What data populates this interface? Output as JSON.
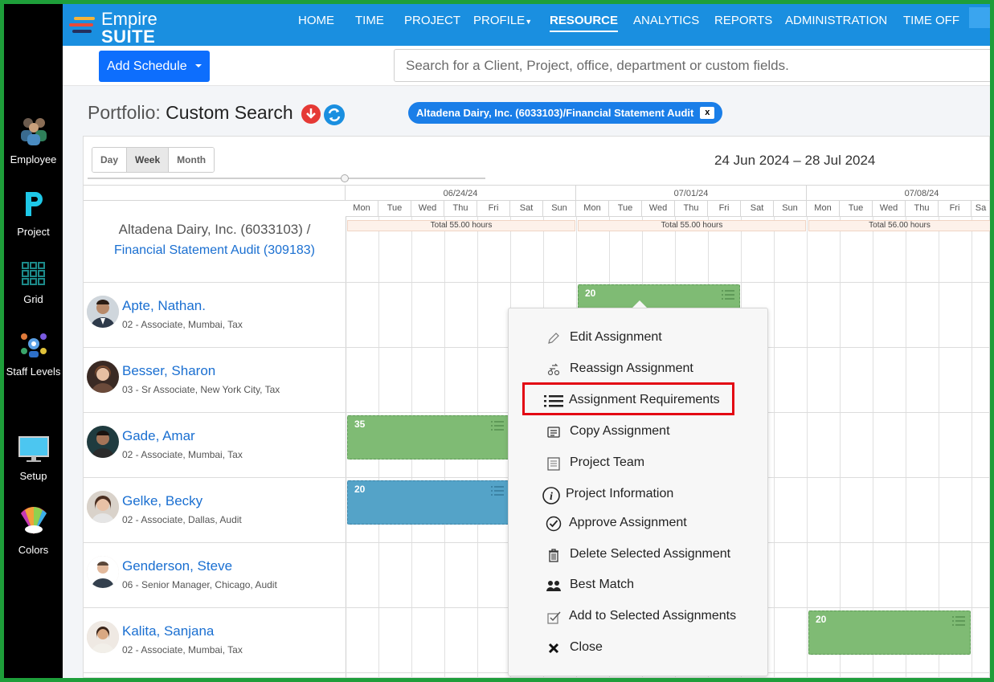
{
  "sidebar": {
    "items": [
      {
        "label": "Employee",
        "icon": "employee-group-icon"
      },
      {
        "label": "Project",
        "icon": "project-p-icon"
      },
      {
        "label": "Grid",
        "icon": "grid-icon"
      },
      {
        "label": "Staff Levels",
        "icon": "staff-levels-icon"
      },
      {
        "label": "Setup",
        "icon": "monitor-icon"
      },
      {
        "label": "Colors",
        "icon": "color-palette-icon"
      }
    ]
  },
  "logo": {
    "line1": "Empire",
    "line2": "SUITE"
  },
  "nav": {
    "items": [
      "HOME",
      "TIME",
      "PROJECT",
      "PROFILE",
      "RESOURCE",
      "ANALYTICS",
      "REPORTS",
      "ADMINISTRATION",
      "TIME OFF"
    ],
    "active": "RESOURCE"
  },
  "toolbar": {
    "add_schedule_label": "Add Schedule",
    "search_placeholder": "Search for a Client, Project, office, department or custom fields."
  },
  "portfolio": {
    "prefix": "Portfolio:",
    "value": "Custom Search",
    "filter_pill": "Altadena Dairy, Inc. (6033103)/Financial Statement Audit",
    "filter_close": "x"
  },
  "calendar": {
    "views": [
      "Day",
      "Week",
      "Month"
    ],
    "active_view": "Week",
    "date_range": "24 Jun 2024 – 28 Jul 2024",
    "weeks": [
      "06/24/24",
      "07/01/24",
      "07/08/24"
    ],
    "days": [
      "Mon",
      "Tue",
      "Wed",
      "Thu",
      "Fri",
      "Sat",
      "Sun",
      "Mon",
      "Tue",
      "Wed",
      "Thu",
      "Fri",
      "Sat",
      "Sun",
      "Mon",
      "Tue",
      "Wed",
      "Thu",
      "Fri",
      "Sa"
    ],
    "totals": [
      "Total 55.00 hours",
      "Total 55.00 hours",
      "Total 56.00 hours"
    ]
  },
  "project": {
    "line1": "Altadena Dairy, Inc. (6033103) /",
    "line2": "Financial Statement Audit (309183)"
  },
  "employees": [
    {
      "name": "Apte, Nathan.",
      "sub": "02 - Associate, Mumbai, Tax"
    },
    {
      "name": "Besser, Sharon",
      "sub": "03 - Sr Associate, New York City, Tax"
    },
    {
      "name": "Gade, Amar",
      "sub": "02 - Associate, Mumbai, Tax"
    },
    {
      "name": "Gelke, Becky",
      "sub": "02 - Associate, Dallas, Audit"
    },
    {
      "name": "Genderson, Steve",
      "sub": "06 - Senior Manager, Chicago, Audit"
    },
    {
      "name": "Kalita, Sanjana",
      "sub": "02 - Associate, Mumbai, Tax"
    }
  ],
  "assignments": [
    {
      "value": "20",
      "color": "#7fbb74"
    },
    {
      "value": "35",
      "color": "#7fbb74"
    },
    {
      "value": "20",
      "color": "#54a3c8"
    },
    {
      "value": "20",
      "color": "#7fbb74"
    }
  ],
  "context_menu": {
    "items": [
      {
        "label": "Edit Assignment",
        "icon": "pencil-icon"
      },
      {
        "label": "Reassign Assignment",
        "icon": "reassign-icon"
      },
      {
        "label": "Assignment Requirements",
        "icon": "list-icon"
      },
      {
        "label": "Copy Assignment",
        "icon": "copy-icon"
      },
      {
        "label": "Project Team",
        "icon": "document-icon"
      },
      {
        "label": "Project Information",
        "icon": "info-icon"
      },
      {
        "label": "Approve Assignment",
        "icon": "check-circle-icon"
      },
      {
        "label": "Delete Selected Assignment",
        "icon": "trash-icon"
      },
      {
        "label": "Best Match",
        "icon": "people-icon"
      },
      {
        "label": "Add to Selected Assignments",
        "icon": "checkbox-icon"
      },
      {
        "label": "Close",
        "icon": "close-icon"
      }
    ],
    "highlighted": "Assignment Requirements",
    "highlight_color": "#e30613"
  },
  "colors": {
    "nav_bg": "#1a8fe0",
    "sidebar_bg": "#000000",
    "frame": "#1e9e3a",
    "button": "#0d6efd"
  }
}
